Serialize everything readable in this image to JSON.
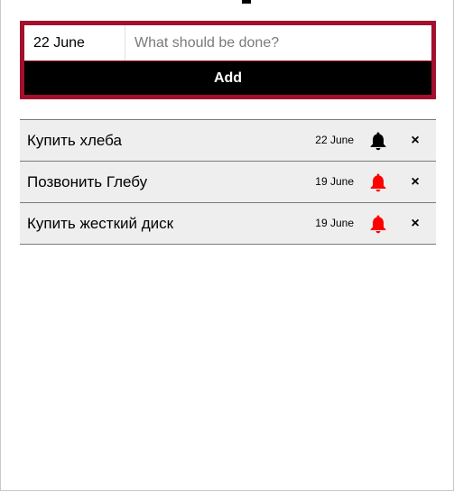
{
  "form": {
    "date_value": "22 June",
    "task_placeholder": "What should be done?",
    "task_value": "",
    "add_label": "Add"
  },
  "tasks": [
    {
      "title": "Купить хлеба",
      "date": "22 June",
      "bell_icon": "bell-icon",
      "bell_color": "#000000",
      "delete_label": "×"
    },
    {
      "title": "Позвонить Глебу",
      "date": "19 June",
      "bell_icon": "bell-icon",
      "bell_color": "#ff0000",
      "delete_label": "×"
    },
    {
      "title": "Купить жесткий диск",
      "date": "19 June",
      "bell_icon": "bell-icon",
      "bell_color": "#ff0000",
      "delete_label": "×"
    }
  ],
  "colors": {
    "form_border": "#a30f2d",
    "add_button_bg": "#000000",
    "row_bg": "#eeeeee",
    "bell_active": "#ff0000",
    "bell_inactive": "#000000"
  }
}
